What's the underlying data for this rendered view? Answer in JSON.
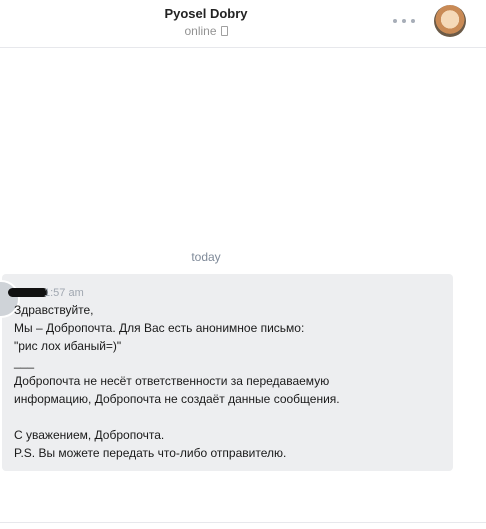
{
  "header": {
    "name": "Pyosel Dobry",
    "status": "online",
    "status_icon": "phone-icon",
    "more_icon": "more-dots-icon"
  },
  "date_separator": "today",
  "message": {
    "time": "1:57 am",
    "lines": [
      "Здравствуйте,",
      "Мы – Добропочта. Для Вас есть анонимное письмо:",
      "\"рис лох ибаный=)\"",
      "___",
      "Добропочта не несёт ответственности за передаваемую",
      "информацию, Добропочта не создаёт данные сообщения.",
      "С уважением, Добропочта.",
      "P.S. Вы можете передать что-либо отправителю."
    ]
  }
}
